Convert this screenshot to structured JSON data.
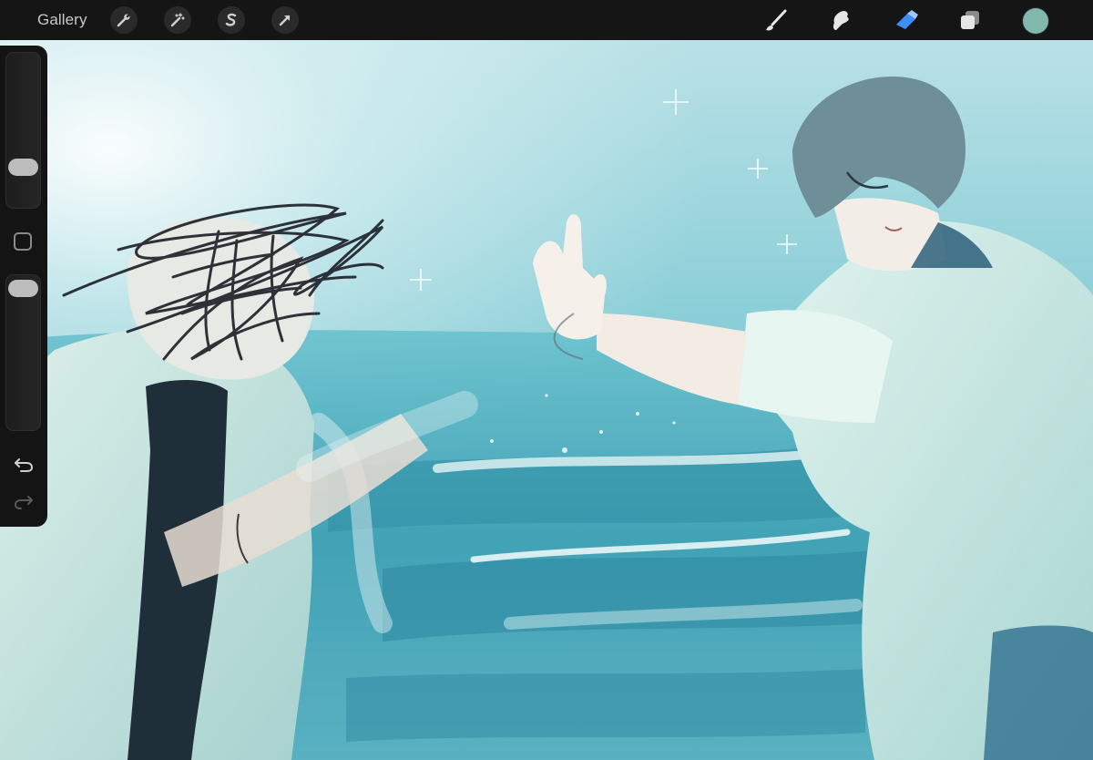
{
  "toolbar": {
    "gallery_label": "Gallery",
    "actions": [
      {
        "name": "actions-wrench-icon"
      },
      {
        "name": "adjustments-magic-wand-icon"
      },
      {
        "name": "selection-s-icon"
      },
      {
        "name": "transform-arrow-icon"
      }
    ],
    "tools": [
      {
        "name": "brush-icon",
        "active": false
      },
      {
        "name": "smudge-icon",
        "active": false
      },
      {
        "name": "eraser-icon",
        "active": true
      },
      {
        "name": "layers-icon",
        "active": false
      }
    ],
    "active_color": "#80b8ad",
    "active_tool_color": "#3d8ef2"
  },
  "sidebar": {
    "brush_size_level": 0.5,
    "opacity_level": 0.93,
    "icons": [
      "undo-icon",
      "redo-icon",
      "modify-square-icon"
    ]
  },
  "canvas": {
    "palette": {
      "sky": "#bfe6ea",
      "sea_deep": "#3a9db0",
      "foam": "#dff3f3",
      "shirt": "#d5ece6",
      "hair": "#6f8f98",
      "scribble": "#1c1e26"
    }
  }
}
